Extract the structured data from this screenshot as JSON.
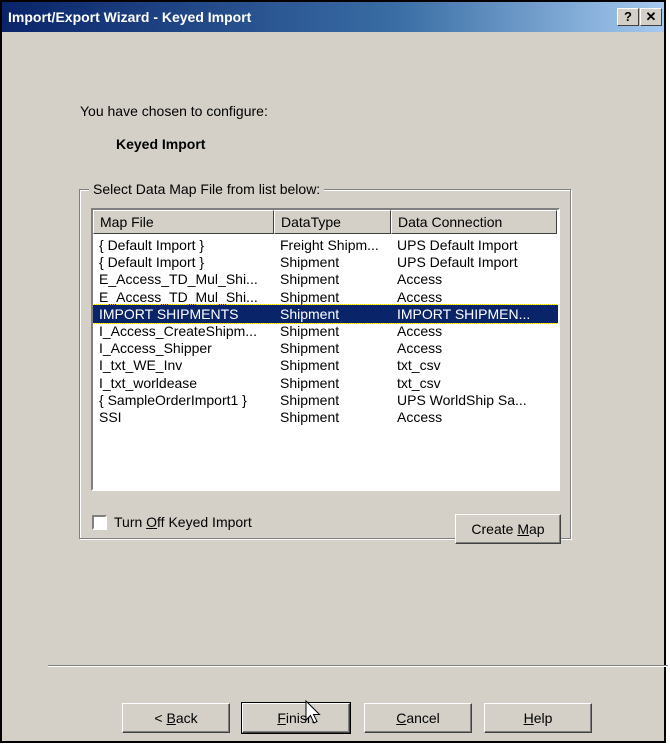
{
  "window": {
    "title": "Import/Export Wizard - Keyed Import",
    "help_label": "?",
    "close_label": "✕"
  },
  "intro": {
    "chosen_text": "You have chosen to configure:",
    "config_name": "Keyed Import"
  },
  "group": {
    "legend": "Select Data Map File from list below:"
  },
  "list": {
    "columns": [
      "Map File",
      "DataType",
      "Data Connection"
    ],
    "rows": [
      {
        "map_file": "{ Default Import }",
        "data_type": "Freight Shipm...",
        "data_connection": "UPS Default Import"
      },
      {
        "map_file": "{ Default Import }",
        "data_type": "Shipment",
        "data_connection": "UPS Default Import"
      },
      {
        "map_file": "E_Access_TD_Mul_Shi...",
        "data_type": "Shipment",
        "data_connection": "Access"
      },
      {
        "map_file": "E_Access_TD_Mul_Shi...",
        "data_type": "Shipment",
        "data_connection": "Access"
      },
      {
        "map_file": "IMPORT SHIPMENTS",
        "data_type": "Shipment",
        "data_connection": "IMPORT SHIPMEN..."
      },
      {
        "map_file": "I_Access_CreateShipm...",
        "data_type": "Shipment",
        "data_connection": "Access"
      },
      {
        "map_file": "I_Access_Shipper",
        "data_type": "Shipment",
        "data_connection": "Access"
      },
      {
        "map_file": "I_txt_WE_Inv",
        "data_type": "Shipment",
        "data_connection": "txt_csv"
      },
      {
        "map_file": "I_txt_worldease",
        "data_type": "Shipment",
        "data_connection": "txt_csv"
      },
      {
        "map_file": "{ SampleOrderImport1 }",
        "data_type": "Shipment",
        "data_connection": "UPS WorldShip Sa..."
      },
      {
        "map_file": "SSI",
        "data_type": "Shipment",
        "data_connection": "Access"
      }
    ],
    "selected_index": 4
  },
  "options": {
    "turn_off_prefix": "Turn ",
    "turn_off_mnemonic": "O",
    "turn_off_suffix": "ff Keyed Import",
    "turn_off_checked": false,
    "create_map_prefix": "Create ",
    "create_map_mnemonic": "M",
    "create_map_suffix": "ap"
  },
  "footer": {
    "back_prefix": "< ",
    "back_mnemonic": "B",
    "back_suffix": "ack",
    "finish_mnemonic": "F",
    "finish_suffix": "inish",
    "cancel_mnemonic": "C",
    "cancel_suffix": "ancel",
    "help_mnemonic": "H",
    "help_suffix": "elp"
  },
  "colors": {
    "title_bar": "#0a246a",
    "selection": "#0a246a",
    "dialog_face": "#d4d0c8"
  }
}
